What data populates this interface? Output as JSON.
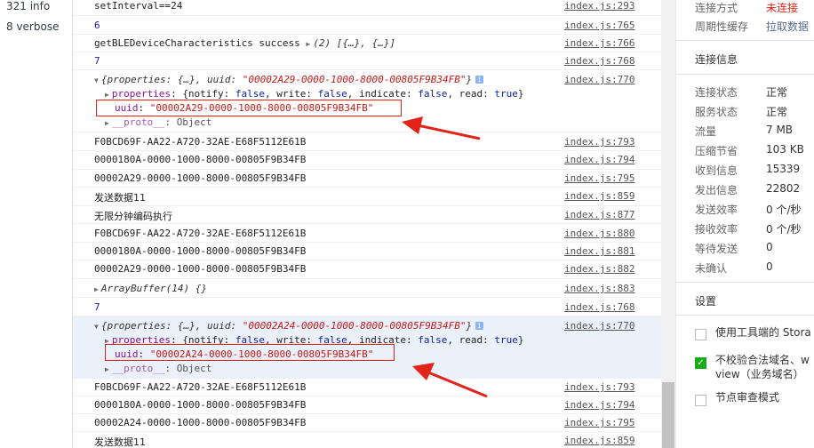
{
  "sidebar": {
    "items": [
      {
        "label": "321 info"
      },
      {
        "label": "8 verbose"
      }
    ]
  },
  "console": {
    "rows": [
      {
        "text": "setInterval==24",
        "src": "index.js:293"
      },
      {
        "text": "6",
        "src": "index.js:765"
      },
      {
        "text": "getBLEDeviceCharacteristics success",
        "extra": "(2) [{…}, {…}]",
        "src": "index.js:766"
      },
      {
        "text": "7",
        "src": "index.js:768"
      },
      {
        "text": "F0BCD69F-AA22-A720-32AE-E68F5112E61B",
        "src": "index.js:793"
      },
      {
        "text": "0000180A-0000-1000-8000-00805F9B34FB",
        "src": "index.js:794"
      },
      {
        "text": "00002A29-0000-1000-8000-00805F9B34FB",
        "src": "index.js:795"
      },
      {
        "text": "发送数据11",
        "src": "index.js:859"
      },
      {
        "text": "无限分钟编码执行",
        "src": "index.js:877"
      },
      {
        "text": "F0BCD69F-AA22-A720-32AE-E68F5112E61B",
        "src": "index.js:880"
      },
      {
        "text": "0000180A-0000-1000-8000-00805F9B34FB",
        "src": "index.js:881"
      },
      {
        "text": "00002A29-0000-1000-8000-00805F9B34FB",
        "src": "index.js:882"
      },
      {
        "text": "ArrayBuffer(14) {}",
        "src": "index.js:883"
      },
      {
        "text": "7",
        "src": "index.js:768"
      },
      {
        "text": "F0BCD69F-AA22-A720-32AE-E68F5112E61B",
        "src": "index.js:793"
      },
      {
        "text": "0000180A-0000-1000-8000-00805F9B34FB",
        "src": "index.js:794"
      },
      {
        "text": "00002A24-0000-1000-8000-00805F9B34FB",
        "src": "index.js:795"
      },
      {
        "text": "发送数据11",
        "src": "index.js:859"
      }
    ],
    "obj1": {
      "summary_prefix": "{properties: {…}, uuid: ",
      "summary_uuid": "\"00002A29-0000-1000-8000-00805F9B34FB\"",
      "summary_suffix": "}",
      "src": "index.js:770",
      "props_key": "properties",
      "props_val_1": "{notify: ",
      "props_false_1": "false",
      "props_val_2": ", write: ",
      "props_false_2": "false",
      "props_val_3": ", indicate: ",
      "props_false_3": "false",
      "props_val_4": ", read: ",
      "props_true": "true",
      "props_val_5": "}",
      "uuid_key": "uuid",
      "uuid_val": "\"00002A29-0000-1000-8000-00805F9B34FB\"",
      "proto_key": "__proto__",
      "proto_val": "Object"
    },
    "obj2": {
      "summary_prefix": "{properties: {…}, uuid: ",
      "summary_uuid": "\"00002A24-0000-1000-8000-00805F9B34FB\"",
      "summary_suffix": "}",
      "src": "index.js:770",
      "props_key": "properties",
      "props_val_1": "{notify: ",
      "props_false_1": "false",
      "props_val_2": ", write: ",
      "props_false_2": "false",
      "props_val_3": ", indicate: ",
      "props_false_3": "false",
      "props_val_4": ", read: ",
      "props_true": "true",
      "props_val_5": "}",
      "uuid_key": "uuid",
      "uuid_val": "\"00002A24-0000-1000-8000-00805F9B34FB\"",
      "proto_key": "__proto__",
      "proto_val": "Object"
    }
  },
  "right_panel": {
    "top": [
      {
        "key": "连接方式",
        "value": "未连接",
        "value_color": "#e2231a"
      },
      {
        "key": "周期性缓存",
        "value": "拉取数据",
        "value_color": "#576b95"
      }
    ],
    "section_title": "连接信息",
    "stats": [
      {
        "key": "连接状态",
        "value": "正常"
      },
      {
        "key": "服务状态",
        "value": "正常"
      },
      {
        "key": "流量",
        "value": "7 MB"
      },
      {
        "key": "压缩节省",
        "value": "103 KB"
      },
      {
        "key": "收到信息",
        "value": "15339"
      },
      {
        "key": "发出信息",
        "value": "22802"
      },
      {
        "key": "发送效率",
        "value": "0 个/秒"
      },
      {
        "key": "接收效率",
        "value": "0 个/秒"
      },
      {
        "key": "等待发送",
        "value": "0"
      },
      {
        "key": "未确认",
        "value": "0"
      }
    ],
    "settings_title": "设置",
    "options": [
      {
        "label": "使用工具端的 Stora",
        "checked": false
      },
      {
        "label_1": "不校验合法域名、w",
        "label_2": "view（业务域名）",
        "checked": true
      },
      {
        "label": "节点审查模式",
        "checked": false
      }
    ]
  },
  "colors": {
    "arrow": "#e2231a",
    "redbox": "#e2231a",
    "highlight": "#eaf1fb"
  }
}
